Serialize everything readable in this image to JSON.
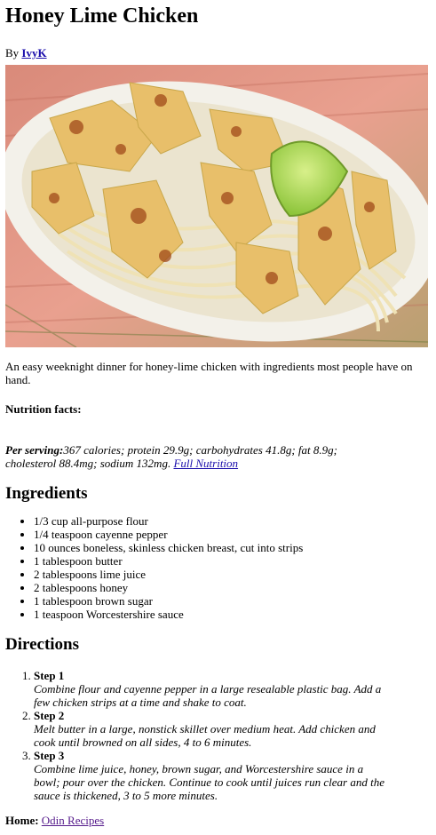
{
  "title": "Honey Lime Chicken",
  "byline": {
    "prefix": "By",
    "author": "IvyK"
  },
  "image": {
    "alt": "honey lime chicken on noodles with lime wedge"
  },
  "intro": "An easy weeknight dinner for honey-lime chicken with ingredients most people have on hand.",
  "nutrition": {
    "label": "Nutrition facts:",
    "per_serving_label": "Per serving:",
    "text": "367 calories; protein 29.9g; carbohydrates 41.8g; fat 8.9g; cholesterol 88.4mg; sodium 132mg.",
    "link": "Full Nutrition"
  },
  "ingredients": {
    "heading": "Ingredients",
    "items": [
      "1/3 cup all-purpose flour",
      "1/4 teaspoon cayenne pepper",
      "10 ounces boneless, skinless chicken breast, cut into strips",
      "1 tablespoon butter",
      "2 tablespoons lime juice",
      "2 tablespoons honey",
      "1 tablespoon brown sugar",
      "1 teaspoon Worcestershire sauce"
    ]
  },
  "directions": {
    "heading": "Directions",
    "steps": [
      {
        "title": "Step 1",
        "text": "Combine flour and cayenne pepper in a large resealable plastic bag. Add a few chicken strips at a time and shake to coat."
      },
      {
        "title": "Step 2",
        "text": "Melt butter in a large, nonstick skillet over medium heat. Add chicken and cook until browned on all sides, 4 to 6 minutes."
      },
      {
        "title": "Step 3",
        "text": "Combine lime juice, honey, brown sugar, and Worcestershire sauce in a bowl; pour over the chicken. Continue to cook until juices run clear and the sauce is thickened, 3 to 5 more minutes."
      }
    ]
  },
  "home": {
    "label": "Home:",
    "link": "Odin Recipes"
  }
}
